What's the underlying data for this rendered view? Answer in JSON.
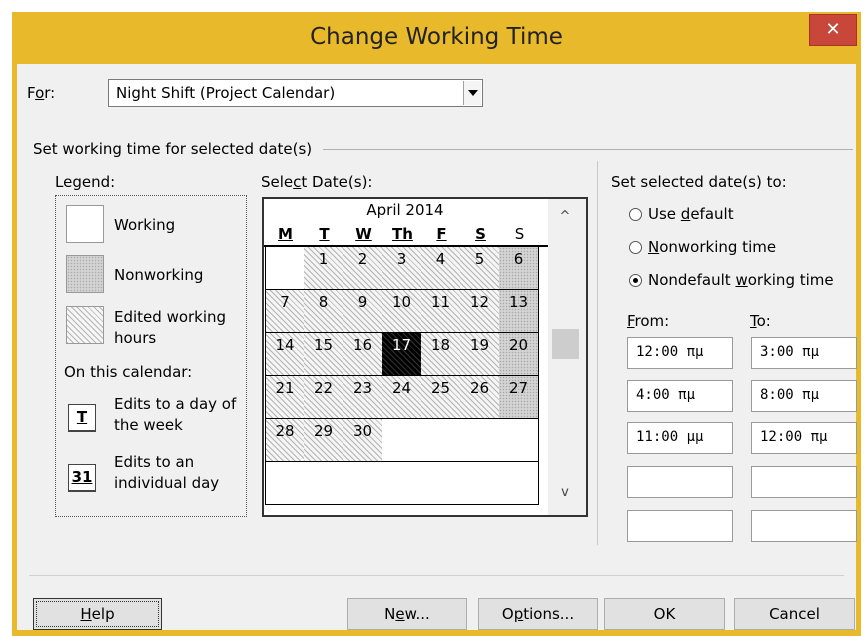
{
  "window": {
    "title": "Change Working Time",
    "close_glyph": "✕"
  },
  "for_row": {
    "label_pre": "F",
    "label_u": "o",
    "label_post": "r:",
    "value": "Night Shift (Project Calendar)"
  },
  "group_label": "Set working time for selected date(s)",
  "legend": {
    "title": "Legend:",
    "working": "Working",
    "nonworking": "Nonworking",
    "edited_1": "Edited working",
    "edited_2": "hours",
    "on_calendar": "On this calendar:",
    "day_week_icon": "T",
    "day_week_1": "Edits to a day of",
    "day_week_2": "the week",
    "individual_icon": "31",
    "individual_1": "Edits to an",
    "individual_2": "individual day"
  },
  "calendar": {
    "select_label_pre": "Sele",
    "select_label_u": "c",
    "select_label_post": "t Date(s):",
    "month": "April 2014",
    "days": [
      "M",
      "T",
      "W",
      "Th",
      "F",
      "S",
      "S"
    ],
    "weeks": [
      [
        {
          "d": "",
          "t": "white"
        },
        {
          "d": "1",
          "t": "edited"
        },
        {
          "d": "2",
          "t": "edited"
        },
        {
          "d": "3",
          "t": "edited"
        },
        {
          "d": "4",
          "t": "edited"
        },
        {
          "d": "5",
          "t": "edited"
        },
        {
          "d": "6",
          "t": "nonwork"
        }
      ],
      [
        {
          "d": "7",
          "t": "edited"
        },
        {
          "d": "8",
          "t": "edited"
        },
        {
          "d": "9",
          "t": "edited"
        },
        {
          "d": "10",
          "t": "edited"
        },
        {
          "d": "11",
          "t": "edited"
        },
        {
          "d": "12",
          "t": "edited"
        },
        {
          "d": "13",
          "t": "nonwork"
        }
      ],
      [
        {
          "d": "14",
          "t": "edited"
        },
        {
          "d": "15",
          "t": "edited"
        },
        {
          "d": "16",
          "t": "edited"
        },
        {
          "d": "17",
          "t": "selected"
        },
        {
          "d": "18",
          "t": "edited"
        },
        {
          "d": "19",
          "t": "edited"
        },
        {
          "d": "20",
          "t": "nonwork"
        }
      ],
      [
        {
          "d": "21",
          "t": "edited"
        },
        {
          "d": "22",
          "t": "edited"
        },
        {
          "d": "23",
          "t": "edited"
        },
        {
          "d": "24",
          "t": "edited"
        },
        {
          "d": "25",
          "t": "edited"
        },
        {
          "d": "26",
          "t": "edited"
        },
        {
          "d": "27",
          "t": "nonwork"
        }
      ],
      [
        {
          "d": "28",
          "t": "edited"
        },
        {
          "d": "29",
          "t": "edited"
        },
        {
          "d": "30",
          "t": "edited"
        },
        {
          "d": "",
          "t": "white"
        },
        {
          "d": "",
          "t": "white"
        },
        {
          "d": "",
          "t": "white"
        },
        {
          "d": "",
          "t": "white"
        }
      ],
      [
        {
          "d": "",
          "t": "white"
        },
        {
          "d": "",
          "t": "white"
        },
        {
          "d": "",
          "t": "white"
        },
        {
          "d": "",
          "t": "white"
        },
        {
          "d": "",
          "t": "white"
        },
        {
          "d": "",
          "t": "white"
        },
        {
          "d": "",
          "t": "white"
        }
      ]
    ],
    "scroll_up_icon": "^",
    "scroll_down_icon": "v"
  },
  "set_to": {
    "title": "Set selected date(s) to:",
    "use_default_pre": "Use ",
    "use_default_u": "d",
    "use_default_post": "efault",
    "nonworking_u": "N",
    "nonworking_post": "onworking time",
    "nondefault_pre": "Nondefault ",
    "nondefault_u": "w",
    "nondefault_post": "orking time",
    "selected": "nondefault",
    "from_u": "F",
    "from_post": "rom:",
    "to_u": "T",
    "to_post": "o:",
    "from": [
      "12:00 πμ",
      "4:00 πμ",
      "11:00 μμ",
      "",
      ""
    ],
    "to": [
      "3:00 πμ",
      "8:00 πμ",
      "12:00 πμ",
      "",
      ""
    ]
  },
  "buttons": {
    "help_u": "H",
    "help_post": "elp",
    "new_pre": "N",
    "new_u": "e",
    "new_post": "w...",
    "options_pre": "O",
    "options_u": "p",
    "options_post": "tions...",
    "ok": "OK",
    "cancel": "Cancel"
  }
}
